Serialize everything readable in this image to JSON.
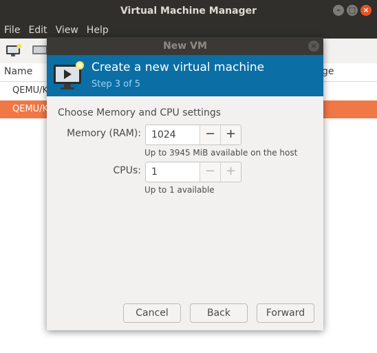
{
  "app": {
    "title": "Virtual Machine Manager",
    "menu": [
      "File",
      "Edit",
      "View",
      "Help"
    ],
    "list": {
      "col_name": "Name",
      "col_usage_partial": "ge",
      "rows": [
        "QEMU/KV",
        "QEMU/KV"
      ]
    }
  },
  "dialog": {
    "title": "New VM",
    "header_title": "Create a new virtual machine",
    "step": "Step 3 of 5",
    "section_label": "Choose Memory and CPU settings",
    "memory": {
      "label": "Memory (RAM):",
      "value": "1024",
      "hint": "Up to 3945 MiB available on the host"
    },
    "cpus": {
      "label": "CPUs:",
      "value": "1",
      "hint": "Up to 1 available"
    },
    "buttons": {
      "cancel": "Cancel",
      "back": "Back",
      "forward": "Forward"
    }
  },
  "colors": {
    "accent": "#0b6ea4",
    "selection": "#f07746",
    "titlebar": "#302f2c"
  },
  "icons": [
    "new-vm-icon",
    "monitor-icon",
    "minimize-icon",
    "maximize-icon",
    "close-icon",
    "minus-icon",
    "plus-icon"
  ]
}
